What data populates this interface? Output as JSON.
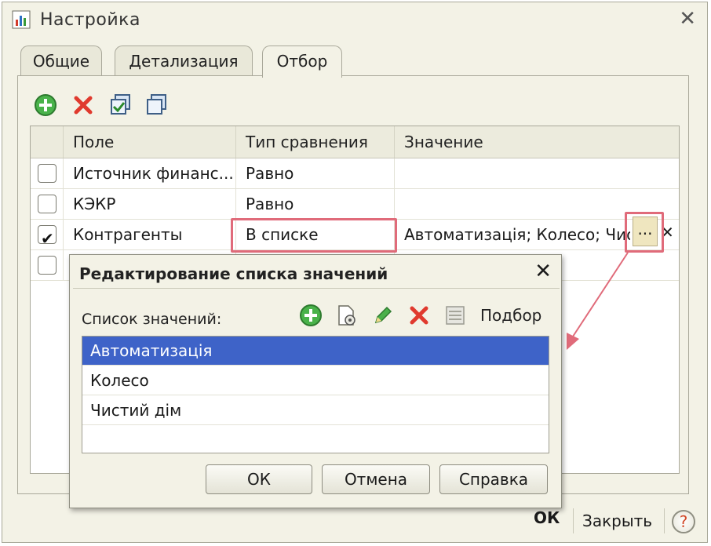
{
  "window": {
    "title": "Настройка"
  },
  "tabs": [
    {
      "label": "Общие",
      "active": false
    },
    {
      "label": "Детализация",
      "active": false
    },
    {
      "label": "Отбор",
      "active": true
    }
  ],
  "toolbar": {
    "icons": [
      "add-icon",
      "delete-icon",
      "check-all-icon",
      "uncheck-all-icon"
    ]
  },
  "grid": {
    "columns": [
      "Поле",
      "Тип сравнения",
      "Значение"
    ],
    "rows": [
      {
        "checked": false,
        "field": "Источник финанс...",
        "compare": "Равно",
        "value": ""
      },
      {
        "checked": false,
        "field": "КЭКР",
        "compare": "Равно",
        "value": ""
      },
      {
        "checked": true,
        "field": "Контрагенты",
        "compare": "В списке",
        "value": "Автоматизація; Колесо; Чис"
      },
      {
        "checked": false,
        "field": "",
        "compare": "",
        "value": ""
      }
    ],
    "dots_label": "...",
    "clear_label": "✕"
  },
  "dialog": {
    "title": "Редактирование списка значений",
    "close_label": "✕",
    "list_label": "Список значений:",
    "podbor_label": "Подбор",
    "items": [
      "Автоматизація",
      "Колесо",
      "Чистий дім"
    ],
    "selected_index": 0,
    "ok_label": "ОК",
    "cancel_label": "Отмена",
    "help_label": "Справка"
  },
  "footer": {
    "ok_label": "ОК",
    "close_label": "Закрыть",
    "help_label": "?"
  },
  "colors": {
    "highlight": "#e06b7a",
    "selection": "#3e63c8",
    "window_bg": "#f3f2e6"
  }
}
